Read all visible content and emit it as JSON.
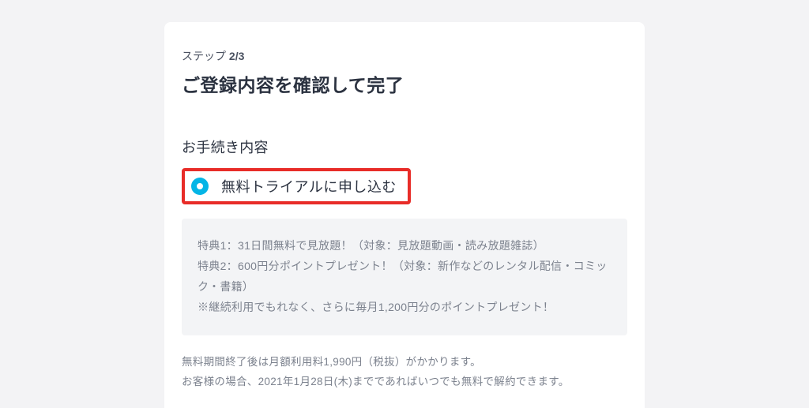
{
  "step": {
    "prefix": "ステップ ",
    "current": "2",
    "sep": "/",
    "total": "3"
  },
  "title": "ご登録内容を確認して完了",
  "section_heading": "お手続き内容",
  "plan_option": {
    "label": "無料トライアルに申し込む"
  },
  "benefits": {
    "line1": "特典1：31日間無料で見放題！（対象：見放題動画・読み放題雑誌）",
    "line2": "特典2：600円分ポイントプレゼント！（対象：新作などのレンタル配信・コミック・書籍）",
    "line3": "※継続利用でもれなく、さらに毎月1,200円分のポイントプレゼント！"
  },
  "fine_print": {
    "line1": "無料期間終了後は月額利用料1,990円（税抜）がかかります。",
    "line2": "お客様の場合、2021年1月28日(木)までであればいつでも無料で解約できます。"
  }
}
